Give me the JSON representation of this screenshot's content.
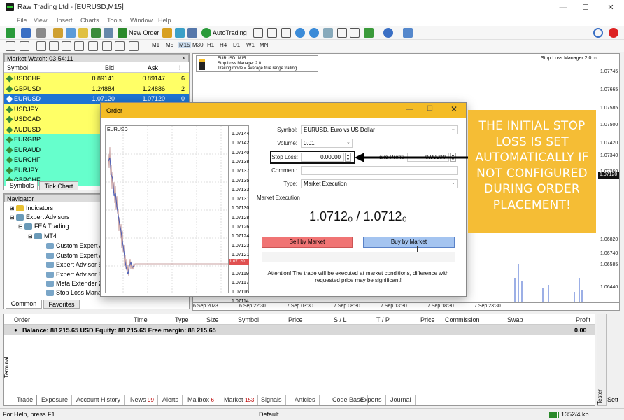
{
  "window": {
    "title": "Raw Trading Ltd - [EURUSD,M15]"
  },
  "menu": [
    "File",
    "View",
    "Insert",
    "Charts",
    "Tools",
    "Window",
    "Help"
  ],
  "toolbar": {
    "new_order": "New Order",
    "autotrading": "AutoTrading"
  },
  "timeframes": [
    "M1",
    "M5",
    "M15",
    "M30",
    "H1",
    "H4",
    "D1",
    "W1",
    "MN"
  ],
  "market_watch": {
    "title": "Market Watch: 03:54:11",
    "columns": {
      "symbol": "Symbol",
      "bid": "Bid",
      "ask": "Ask",
      "spread": "!"
    },
    "rows": [
      {
        "symbol": "USDCHF",
        "bid": "0.89141",
        "ask": "0.89147",
        "spread": "6",
        "bg": "#ffff66"
      },
      {
        "symbol": "GBPUSD",
        "bid": "1.24884",
        "ask": "1.24886",
        "spread": "2",
        "bg": "#ffff66"
      },
      {
        "symbol": "EURUSD",
        "bid": "1.07120",
        "ask": "1.07120",
        "spread": "0",
        "bg": "#1e73d2"
      },
      {
        "symbol": "USDJPY",
        "bid": "14",
        "ask": "",
        "spread": "",
        "bg": "#ffff66"
      },
      {
        "symbol": "USDCAD",
        "bid": "1.3",
        "ask": "",
        "spread": "",
        "bg": "#ffff66"
      },
      {
        "symbol": "AUDUSD",
        "bid": "0.6",
        "ask": "",
        "spread": "",
        "bg": "#ffff66"
      },
      {
        "symbol": "EURGBP",
        "bid": "0.8",
        "ask": "",
        "spread": "",
        "bg": "#66ffcc"
      },
      {
        "symbol": "EURAUD",
        "bid": "1.6",
        "ask": "",
        "spread": "",
        "bg": "#66ffcc"
      },
      {
        "symbol": "EURCHF",
        "bid": "0.9",
        "ask": "",
        "spread": "",
        "bg": "#66ffcc"
      },
      {
        "symbol": "EURJPY",
        "bid": "157",
        "ask": "",
        "spread": "",
        "bg": "#66ffcc"
      },
      {
        "symbol": "GBPCHF",
        "bid": "1.1",
        "ask": "",
        "spread": "",
        "bg": "#66ffcc"
      }
    ],
    "tabs": [
      "Symbols",
      "Tick Chart"
    ]
  },
  "navigator": {
    "title": "Navigator",
    "items": [
      "Indicators",
      "Expert Advisors",
      "FEA Trading",
      "MT4",
      "Custom Expert A",
      "Custom Expert A",
      "Expert Advisor E",
      "Expert Advisor E",
      "Meta Extender 2",
      "Stop Loss Mana"
    ],
    "tabs": [
      "Common",
      "Favorites"
    ]
  },
  "chart": {
    "symbol": "EURUSD, M15",
    "ea_name": "Stop Loss Manager 2.0",
    "ea_mode": "Trailing mode = Average true range trailing",
    "ea_right": "Stop Loss Manager 2.0 ☺",
    "prices": [
      "1.07745",
      "1.07665",
      "1.07585",
      "1.07500",
      "1.07420",
      "1.07340",
      "1.07260",
      "1.07120",
      "1.06820",
      "1.06740",
      "1.06585",
      "1.06440"
    ],
    "times": [
      "6 Sep 2023",
      "6 Sep 22:30",
      "7 Sep 03:30",
      "7 Sep 08:30",
      "7 Sep 13:30",
      "7 Sep 18:30",
      "7 Sep 23:30"
    ]
  },
  "order": {
    "title": "Order",
    "mini_symbol": "EURUSD",
    "mini_prices": [
      "1.07144",
      "1.07142",
      "1.07140",
      "1.07138",
      "1.07137",
      "1.07135",
      "1.07133",
      "1.07131",
      "1.07130",
      "1.07128",
      "1.07126",
      "1.07124",
      "1.07123",
      "1.07121",
      "1.07120",
      "1.07119",
      "1.07117",
      "1.07116",
      "1.07114"
    ],
    "labels": {
      "symbol": "Symbol:",
      "volume": "Volume:",
      "stop_loss": "Stop Loss:",
      "take_profit": "Take Profit:",
      "comment": "Comment:",
      "type": "Type:"
    },
    "values": {
      "symbol": "EURUSD, Euro vs US Dollar",
      "volume": "0.01",
      "stop_loss": "0.00000",
      "take_profit": "0.00000",
      "type": "Market Execution"
    },
    "section": "Market Execution",
    "quote": "1.0712₀ / 1.0712₀",
    "sell": "Sell by Market",
    "buy": "Buy by Market",
    "attention": "Attention! The trade will be executed at market conditions, difference with requested price may be significant!"
  },
  "callout": {
    "text": "THE INITIAL STOP LOSS IS SET AUTOMATICALLY IF NOT CONFIGURED DURING ORDER PLACEMENT!"
  },
  "terminal": {
    "side_label": "Terminal",
    "columns": [
      "Order",
      "Time",
      "Type",
      "Size",
      "Symbol",
      "Price",
      "S / L",
      "T / P",
      "Price",
      "Commission",
      "Swap",
      "Profit"
    ],
    "balance": "Balance: 88 215.65 USD  Equity: 88 215.65  Free margin: 88 215.65",
    "balance_value": "0.00",
    "tabs": [
      {
        "label": "Trade",
        "badge": ""
      },
      {
        "label": "Exposure",
        "badge": ""
      },
      {
        "label": "Account History",
        "badge": ""
      },
      {
        "label": "News",
        "badge": "99"
      },
      {
        "label": "Alerts",
        "badge": ""
      },
      {
        "label": "Mailbox",
        "badge": "6"
      },
      {
        "label": "Market",
        "badge": "153"
      },
      {
        "label": "Signals",
        "badge": ""
      },
      {
        "label": "Articles",
        "badge": ""
      },
      {
        "label": "Code Base",
        "badge": ""
      },
      {
        "label": "Experts",
        "badge": ""
      },
      {
        "label": "Journal",
        "badge": ""
      }
    ],
    "tester_label": "Tester",
    "tester_tab": "Sett"
  },
  "status": {
    "help": "For Help, press F1",
    "profile": "Default",
    "traffic": "1352/4 kb"
  }
}
